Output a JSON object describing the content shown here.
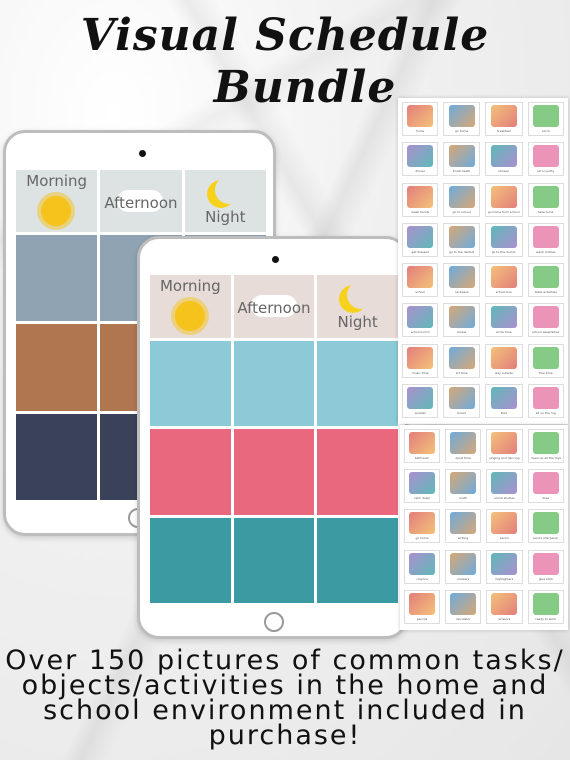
{
  "title": {
    "line1": "Visual Schedule",
    "line2": "Bundle"
  },
  "schedule_headers": {
    "morning": "Morning",
    "afternoon": "Afternoon",
    "night": "Night"
  },
  "tablet_back": {
    "header_color": "#dde3e3",
    "row_colors": [
      "#8fa3b3",
      "#b0764f",
      "#3a4259"
    ]
  },
  "tablet_front": {
    "header_color": "#e7dcd8",
    "row_colors": [
      "#8ccad8",
      "#e9687e",
      "#3b9aa2"
    ]
  },
  "picture_cards_sheet1": [
    "home",
    "go home",
    "breakfast",
    "lunch",
    "dinner",
    "brush teeth",
    "shower",
    "sit on potty",
    "wash hands",
    "go to school",
    "go home from school",
    "take turns",
    "get dressed",
    "go to the dentist",
    "go to the doctor",
    "wash clothes",
    "school",
    "backpack",
    "school bus",
    "table activities",
    "school lunch",
    "recess",
    "circle time",
    "school assemblies",
    "music time",
    "art time",
    "play outside",
    "free time",
    "puzzles",
    "board",
    "iPad",
    "sit on the rug"
  ],
  "picture_cards_sheet2": [
    "bathroom",
    "quiet time",
    "singing and dancing",
    "clean up all the toys",
    "calm down",
    "math",
    "social studies",
    "draw",
    "go home",
    "writing",
    "pencil",
    "pencil sharpener",
    "crayons",
    "markers",
    "highlighters",
    "glue stick",
    "pencils",
    "calculator",
    "scissors",
    "ready to work"
  ],
  "footer": {
    "line1": "Over 150 pictures of common tasks/",
    "line2": "objects/activities in the home and",
    "line3": "school environment included in",
    "line4": "purchase!"
  }
}
